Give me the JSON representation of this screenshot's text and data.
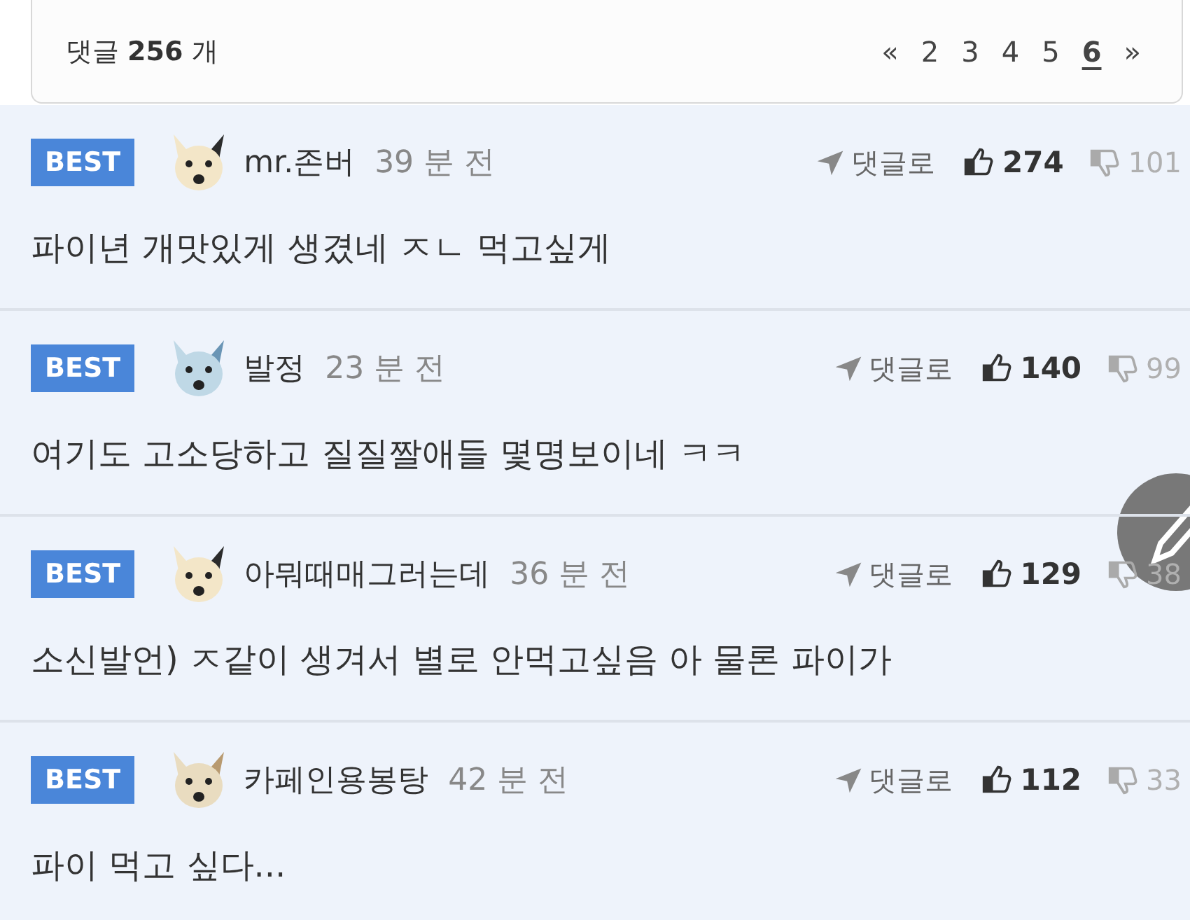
{
  "comment_summary": {
    "label": "댓글",
    "count": "256",
    "unit": "개"
  },
  "pagination": {
    "first": "«",
    "last": "»",
    "pages": [
      {
        "label": "2",
        "selected": false
      },
      {
        "label": "3",
        "selected": false
      },
      {
        "label": "4",
        "selected": false
      },
      {
        "label": "5",
        "selected": false
      },
      {
        "label": "6",
        "selected": true
      }
    ]
  },
  "comments": [
    {
      "badge": "BEST",
      "author": "mr.존버",
      "time": "39 분 전",
      "reply": "댓글로",
      "likes": "274",
      "dislikes": "101",
      "text": "파이년 개맛있게 생겼네 ㅈㄴ 먹고싶게"
    },
    {
      "badge": "BEST",
      "author": "발정",
      "time": "23 분 전",
      "reply": "댓글로",
      "likes": "140",
      "dislikes": "99",
      "text": "여기도 고소당하고 질질짤애들 몇명보이네 ㅋㅋ"
    },
    {
      "badge": "BEST",
      "author": "아뭐때매그러는데",
      "time": "36 분 전",
      "reply": "댓글로",
      "likes": "129",
      "dislikes": "38",
      "text": "소신발언) ㅈ같이 생겨서 별로 안먹고싶음 아 물론 파이가"
    },
    {
      "badge": "BEST",
      "author": "카페인용봉탕",
      "time": "42 분 전",
      "reply": "댓글로",
      "likes": "112",
      "dislikes": "33",
      "text": "파이 먹고 싶다..."
    }
  ]
}
